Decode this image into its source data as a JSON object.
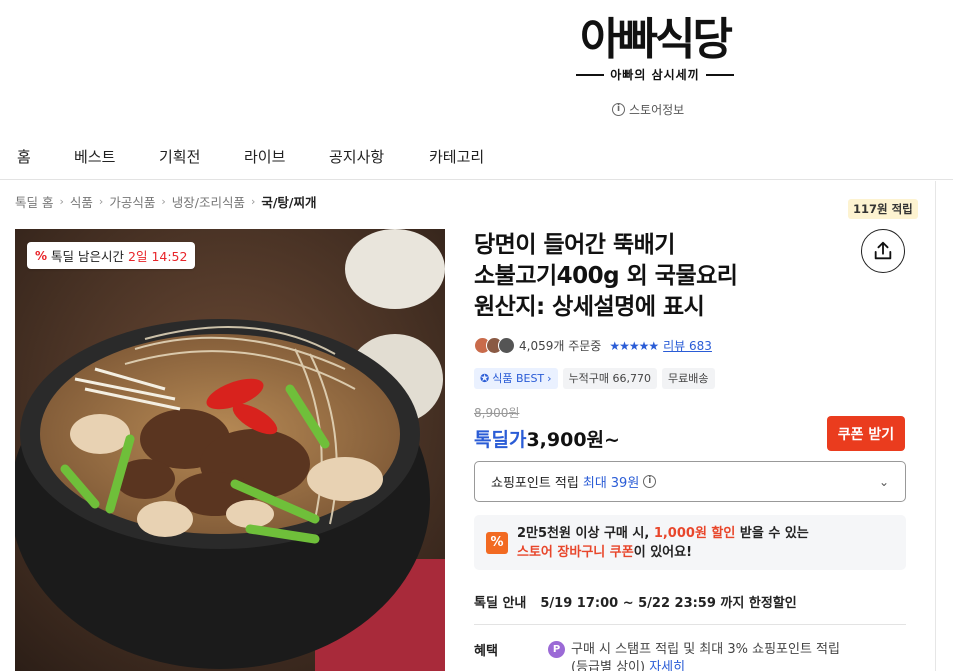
{
  "header": {
    "logo_title": "아빠식당",
    "logo_subtitle": "아빠의 삼시세끼",
    "store_info_label": "스토어정보"
  },
  "nav": {
    "items": [
      "홈",
      "베스트",
      "기획전",
      "라이브",
      "공지사항",
      "카테고리"
    ]
  },
  "breadcrumb": {
    "items": [
      "톡딜 홈",
      "식품",
      "가공식품",
      "냉장/조리식품",
      "국/탕/찌개"
    ]
  },
  "timer": {
    "label": "톡딜 남은시간",
    "value": "2일 14:52"
  },
  "points_badge": "117원 적립",
  "product": {
    "title_line1": "당면이 들어간 뚝배기",
    "title_line2": "소불고기400g 외 국물요리",
    "title_line3": "원산지: 상세설명에 표시",
    "order_count": "4,059개 주문중",
    "stars": "★★★★★",
    "review_label": "리뷰 683",
    "tags": [
      "식품 BEST",
      "누적구매 66,770",
      "무료배송"
    ],
    "original_price": "8,900원",
    "deal_label": "톡딜가",
    "deal_price": "3,900원~",
    "coupon_button": "쿠폰 받기"
  },
  "point_select": {
    "label": "쇼핑포인트 적립",
    "prefix": "최대",
    "amount": "39원"
  },
  "promo": {
    "line1_a": "2만5천원 이상 구매 시, ",
    "line1_b": "1,000원 할인",
    "line1_c": " 받을 수 있는",
    "line2_a": "스토어 장바구니 쿠폰",
    "line2_b": "이 있어요!"
  },
  "deal_info": {
    "label": "톡딜 안내",
    "value": "5/19 17:00 ~ 5/22 23:59 까지 한정할인"
  },
  "benefit": {
    "label": "혜택",
    "text_line1": "구매 시 스탬프 적립 및 최대 3% 쇼핑포인트 적립",
    "text_line2": "(등급별 상이)",
    "link": "자세히"
  },
  "colors": {
    "accent_blue": "#2a5cd6",
    "coupon_red": "#ea3c1e",
    "timer_red": "#e8262b",
    "promo_orange": "#f26a22"
  }
}
